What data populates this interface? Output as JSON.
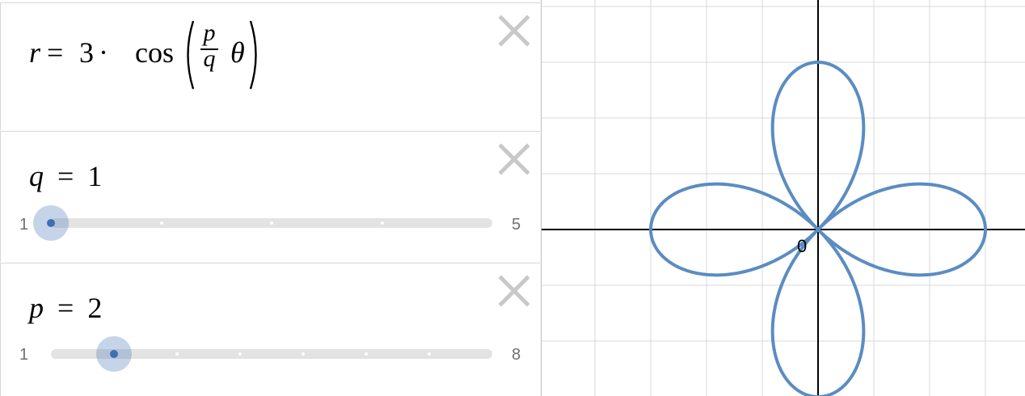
{
  "expressions": {
    "polar": {
      "lhs": "r",
      "eq": "=",
      "coef": "3",
      "dot": "·",
      "func": "cos",
      "frac_num": "p",
      "frac_den": "q",
      "var": "θ"
    },
    "slider_q": {
      "name": "q",
      "eq": "=",
      "value": 1,
      "value_text": "1",
      "min": "1",
      "max": "5",
      "min_val": 1,
      "max_val": 5,
      "step": 1
    },
    "slider_p": {
      "name": "p",
      "eq": "=",
      "value": 2,
      "value_text": "2",
      "min": "1",
      "max": "8",
      "min_val": 1,
      "max_val": 8,
      "step": 1
    }
  },
  "graph": {
    "origin_label": "0",
    "curve_color": "#5b8cc2",
    "axis_color": "#000000",
    "grid_color": "#d9d9d9",
    "amplitude": 3
  },
  "icons": {
    "delete": "close-icon"
  },
  "colors": {
    "slider_handle": "#3f6eb1",
    "slider_track": "#e3e3e3",
    "delete_icon": "#c8c8c8"
  }
}
